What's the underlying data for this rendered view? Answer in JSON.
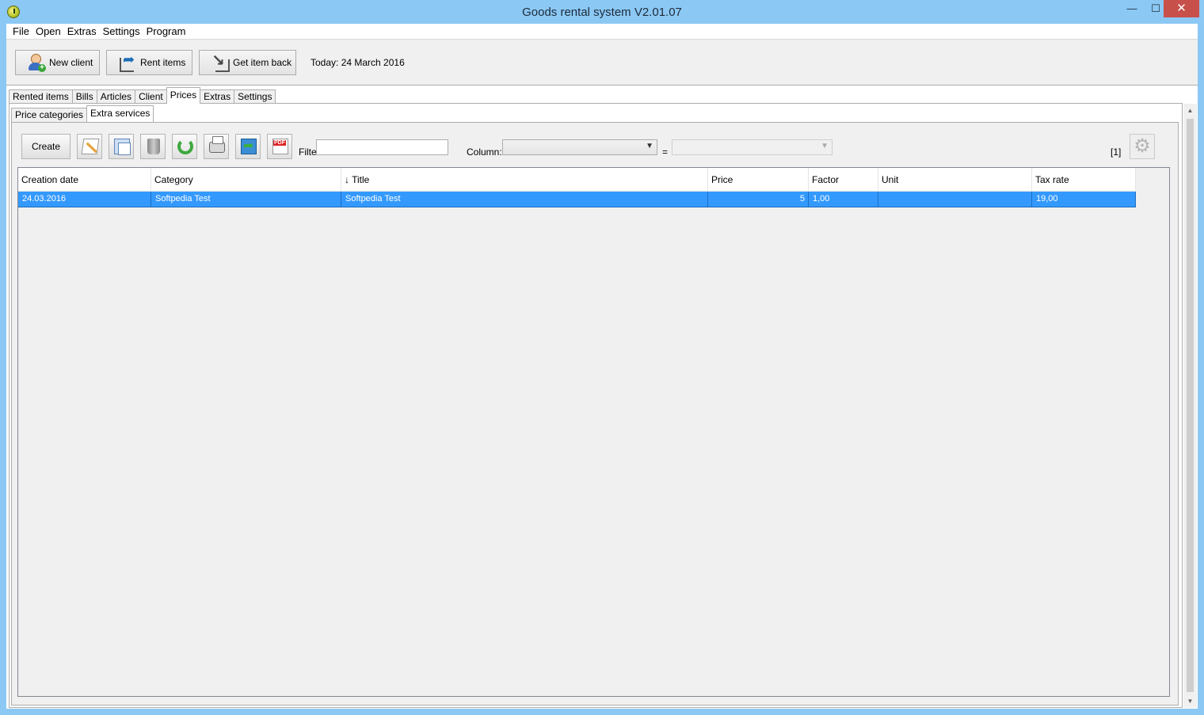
{
  "window": {
    "title": "Goods rental system V2.01.07",
    "min_glyph": "—",
    "max_glyph": "☐",
    "close_glyph": "✕"
  },
  "menu": [
    "File",
    "Open",
    "Extras",
    "Settings",
    "Program"
  ],
  "toolbar": {
    "new_client": "New client",
    "rent_items": "Rent items",
    "get_item_back": "Get item back",
    "today": "Today: 24 March 2016"
  },
  "tabs": [
    "Rented items",
    "Bills",
    "Articles",
    "Client",
    "Prices",
    "Extras",
    "Settings"
  ],
  "active_tab": "Prices",
  "subtabs": [
    "Price categories",
    "Extra services"
  ],
  "active_subtab": "Extra services",
  "list_toolbar": {
    "create": "Create",
    "filter_label": "Filter:",
    "filter_value": "",
    "column_label": "Column:",
    "column_value": "",
    "equals": "=",
    "value_value": "",
    "count": "[1]"
  },
  "grid": {
    "columns": [
      "Creation date",
      "Category",
      "↓ Title",
      "Price",
      "Factor",
      "Unit",
      "Tax rate"
    ],
    "rows": [
      [
        "24.03.2016",
        "Softpedia Test",
        "Softpedia Test",
        "5",
        "1,00",
        "",
        "19,00"
      ]
    ]
  },
  "colors": {
    "title_bar": "#8cc8f4",
    "selection": "#3399ff",
    "close_button": "#c7504a"
  },
  "icons": {
    "new_client": "user-add-icon",
    "rent_items": "rent-out-icon",
    "get_item_back": "return-icon",
    "edit": "edit-icon",
    "copy": "copy-icon",
    "delete": "trash-icon",
    "refresh": "refresh-icon",
    "print": "print-icon",
    "export": "export-icon",
    "pdf": "pdf-icon",
    "settings": "gear-icon"
  }
}
